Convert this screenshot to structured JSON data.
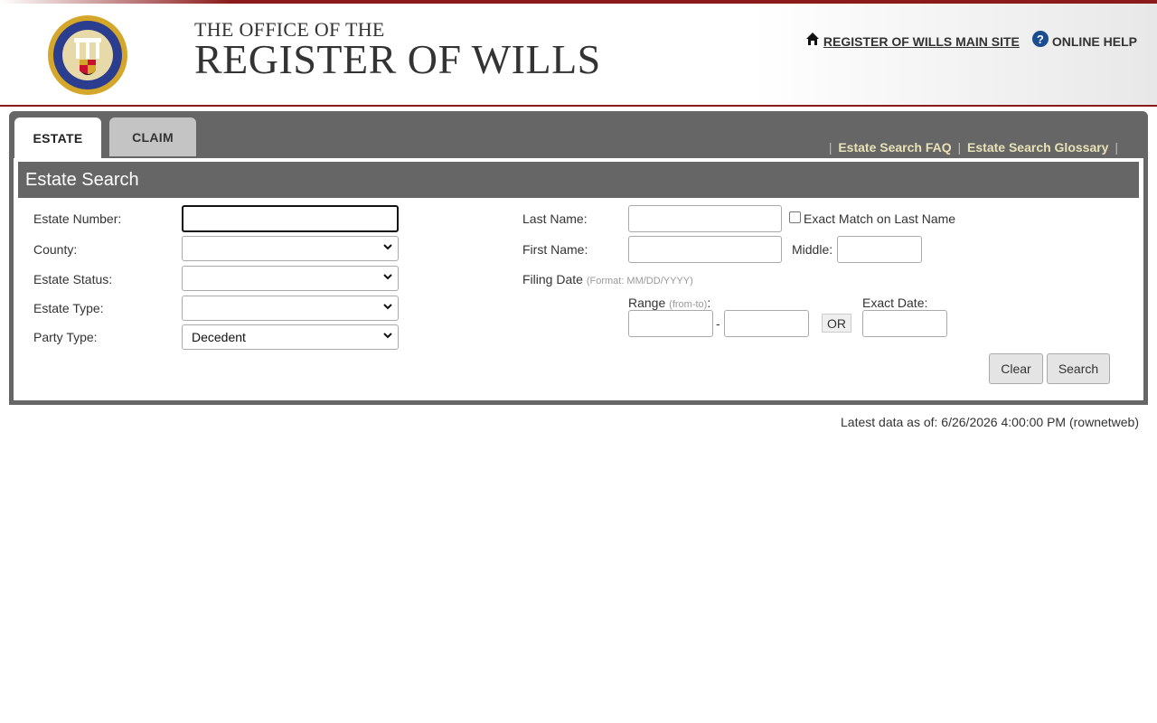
{
  "header": {
    "title_small": "THE OFFICE OF THE",
    "title_big": "REGISTER OF WILLS",
    "main_site_link": " REGISTER OF WILLS MAIN SITE",
    "help_link": "ONLINE HELP",
    "help_glyph": "?"
  },
  "tabs": [
    {
      "label": "ESTATE",
      "active": true
    },
    {
      "label": "CLAIM",
      "active": false
    }
  ],
  "panel_links": {
    "faq": "Estate Search FAQ",
    "glossary": "Estate Search Glossary",
    "separator": "|"
  },
  "form": {
    "section_title": "Estate Search",
    "estate_number_label": "Estate Number:",
    "estate_number_value": "",
    "county_label": "County:",
    "county_value": "",
    "estate_status_label": "Estate Status:",
    "estate_status_value": "",
    "estate_type_label": "Estate Type:",
    "estate_type_value": "",
    "party_type_label": "Party Type:",
    "party_type_value": "Decedent",
    "last_name_label": "Last Name:",
    "last_name_value": "",
    "exact_match_label": "Exact Match on Last Name",
    "exact_match_checked": false,
    "first_name_label": "First Name:",
    "first_name_value": "",
    "middle_label": "Middle:",
    "middle_value": "",
    "filing_date_label": "Filing Date",
    "filing_date_format": "(Format: MM/DD/YYYY)",
    "range_label": "Range",
    "range_hint": "(from-to)",
    "range_colon": ":",
    "range_dash": "-",
    "or_label": "OR",
    "exact_date_label": "Exact Date:",
    "clear_button": "Clear",
    "search_button": "Search"
  },
  "footer": {
    "latest_data": "Latest data as of: 6/26/2026 4:00:00 PM (rownetweb)"
  },
  "colors": {
    "accent_maroon": "#8b1a1a",
    "panel_gray": "#666666",
    "panel_link": "#e7e1b5",
    "help_blue": "#1a4d8f"
  }
}
